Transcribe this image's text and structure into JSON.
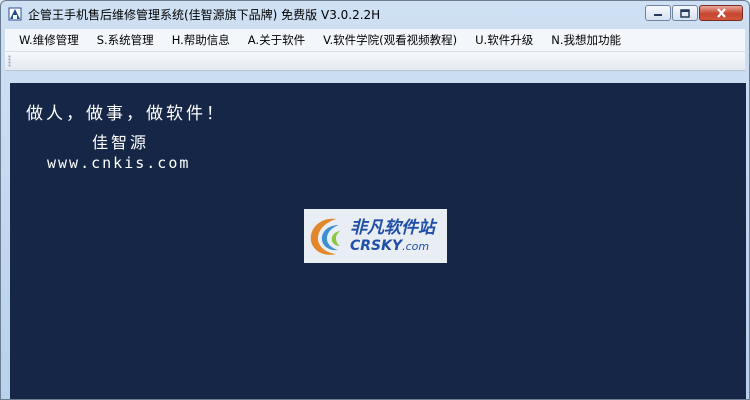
{
  "window": {
    "title": "企管王手机售后维修管理系统(佳智源旗下品牌) 免费版 V3.0.2.2H",
    "controls": [
      "minimize",
      "maximize",
      "close"
    ]
  },
  "menu": [
    {
      "label": "W.维修管理"
    },
    {
      "label": "S.系统管理"
    },
    {
      "label": "H.帮助信息"
    },
    {
      "label": "A.关于软件"
    },
    {
      "label": "V.软件学院(观看视频教程)"
    },
    {
      "label": "U.软件升级"
    },
    {
      "label": "N.我想加功能"
    }
  ],
  "content": {
    "slogan": "做人，做事，做软件！",
    "company": "佳智源",
    "website": "www.cnkis.com",
    "background_color": "#152646"
  },
  "watermark": {
    "cn_text": "非凡软件站",
    "en_text": "CRSKY",
    "domain": ".com"
  }
}
